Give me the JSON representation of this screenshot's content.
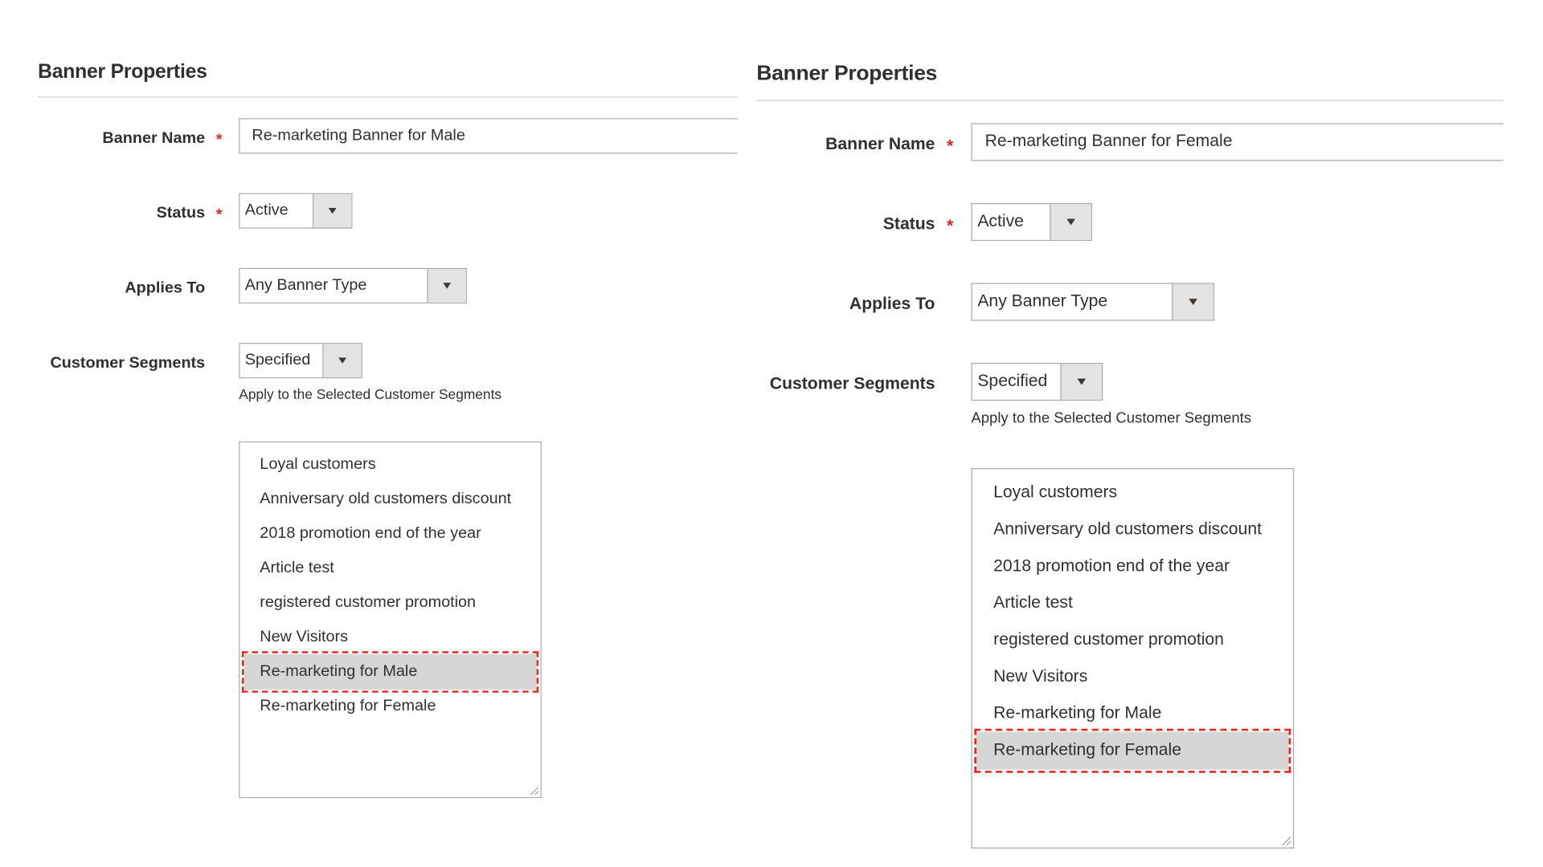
{
  "colors": {
    "required": "#e22626",
    "highlight_dash": "#e8261f",
    "selected_bg": "#d6d6d6"
  },
  "panels": [
    {
      "title": "Banner Properties",
      "banner_name": {
        "label": "Banner Name",
        "required": "*",
        "value": "Re-marketing Banner for Male"
      },
      "status": {
        "label": "Status",
        "required": "*",
        "value": "Active"
      },
      "applies_to": {
        "label": "Applies To",
        "value": "Any Banner Type"
      },
      "customer_segments": {
        "label": "Customer Segments",
        "value": "Specified",
        "note": "Apply to the Selected Customer Segments"
      },
      "segments": [
        "Loyal customers",
        "Anniversary old customers discount",
        "2018 promotion end of the year",
        "Article test",
        "registered customer promotion",
        "New Visitors",
        "Re-marketing for Male",
        "Re-marketing for Female"
      ],
      "selected_segment": "Re-marketing for Male"
    },
    {
      "title": "Banner Properties",
      "banner_name": {
        "label": "Banner Name",
        "required": "*",
        "value": "Re-marketing Banner for Female"
      },
      "status": {
        "label": "Status",
        "required": "*",
        "value": "Active"
      },
      "applies_to": {
        "label": "Applies To",
        "value": "Any Banner Type"
      },
      "customer_segments": {
        "label": "Customer Segments",
        "value": "Specified",
        "note": "Apply to the Selected Customer Segments"
      },
      "segments": [
        "Loyal customers",
        "Anniversary old customers discount",
        "2018 promotion end of the year",
        "Article test",
        "registered customer promotion",
        "New Visitors",
        "Re-marketing for Male",
        "Re-marketing for Female"
      ],
      "selected_segment": "Re-marketing for Female"
    }
  ]
}
